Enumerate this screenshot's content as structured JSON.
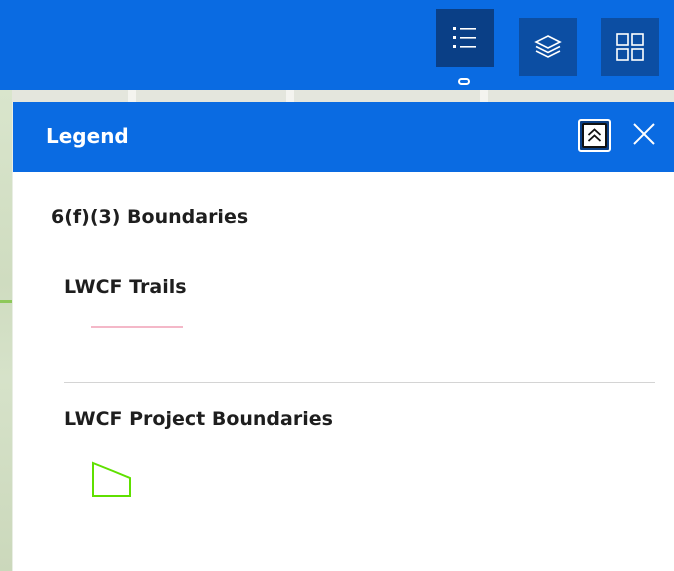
{
  "toolbar": {
    "buttons": [
      {
        "name": "legend-list-icon",
        "active": true
      },
      {
        "name": "layers-icon",
        "active": false
      },
      {
        "name": "basemap-gallery-icon",
        "active": false
      }
    ]
  },
  "legend_panel": {
    "title": "Legend",
    "collapse_icon": "double-chevron-up-icon",
    "close_icon": "close-icon",
    "group_title": "6(f)(3) Boundaries",
    "layers": [
      {
        "title": "LWCF Trails",
        "symbol": "line",
        "color": "#f4b8c8"
      },
      {
        "title": "LWCF Project Boundaries",
        "symbol": "polygon",
        "color": "#5fe000"
      }
    ]
  },
  "colors": {
    "header_blue": "#0a6be2",
    "button_navy": "#0c4ea3"
  }
}
